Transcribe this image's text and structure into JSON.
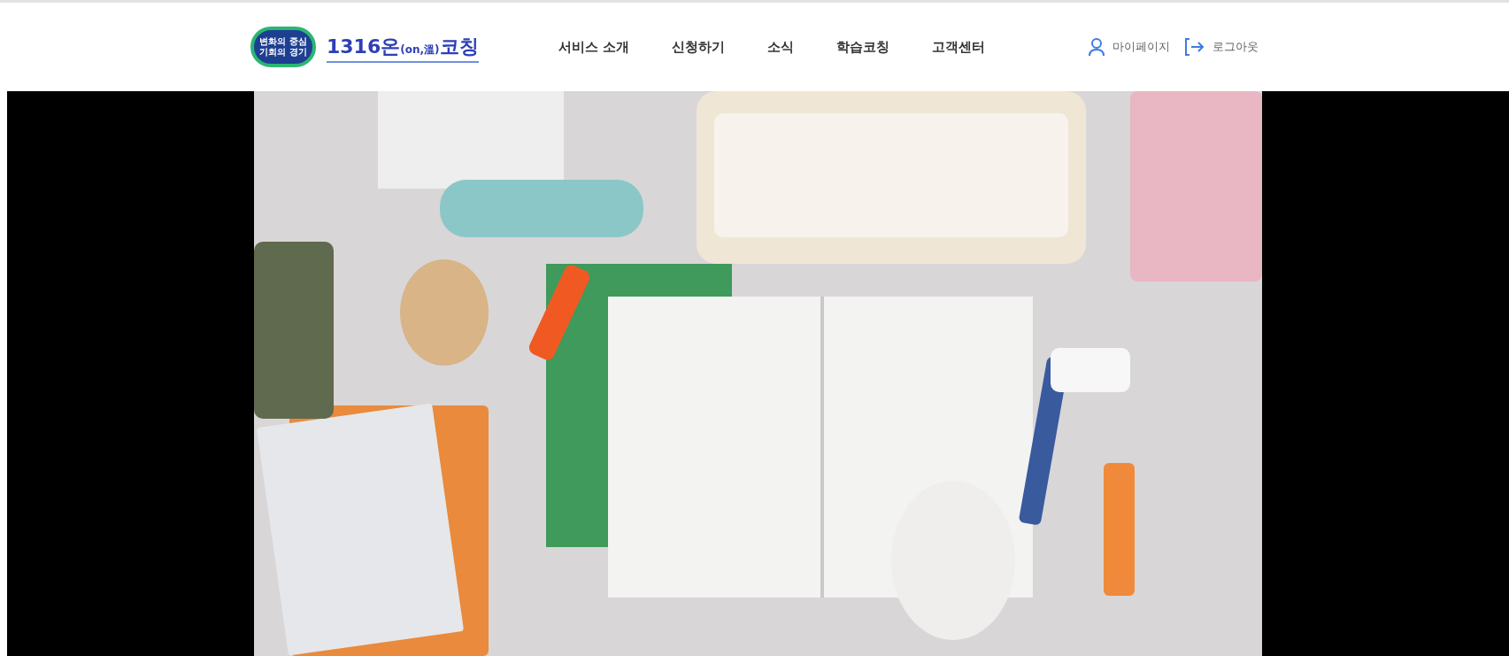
{
  "logo": {
    "slogan_lines": [
      "변화의 중심",
      "기회의 경기"
    ],
    "title": "1316온",
    "title_sub": "(on,溫)",
    "title_end": "코칭"
  },
  "nav": [
    {
      "label": "서비스 소개"
    },
    {
      "label": "신청하기"
    },
    {
      "label": "소식"
    },
    {
      "label": "학습코칭"
    },
    {
      "label": "고객센터"
    }
  ],
  "user_links": [
    {
      "kind": "mypage",
      "label": "마이페이지"
    },
    {
      "kind": "logout",
      "label": "로그아웃"
    }
  ]
}
